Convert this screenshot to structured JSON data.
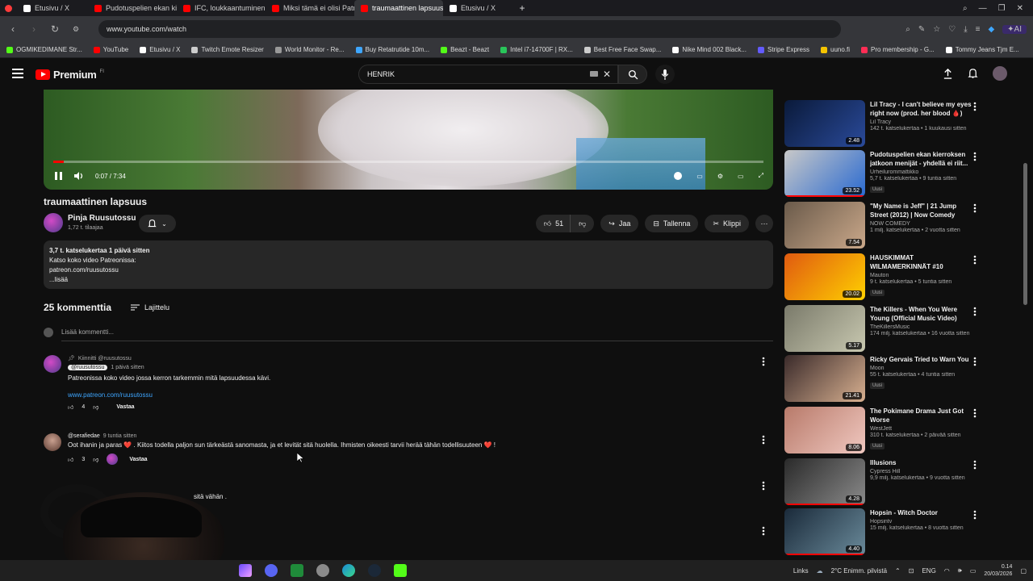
{
  "browser": {
    "tabs": [
      {
        "label": "Etusivu / X",
        "color": "#ffffff",
        "active": false
      },
      {
        "label": "Pudotuspelien ekan kierro",
        "color": "#ff0000",
        "active": false
      },
      {
        "label": "IFC, loukkaantuminen &",
        "color": "#ff0000",
        "active": false
      },
      {
        "label": "Miksi tämä ei olisi Patrik L",
        "color": "#ff0000",
        "active": false
      },
      {
        "label": "traumaattinen lapsuus",
        "color": "#ff0000",
        "active": true
      },
      {
        "label": "Etusivu / X",
        "color": "#ffffff",
        "active": false
      }
    ],
    "new_tab": "+",
    "url": "www.youtube.com/watch",
    "ai_label": "AI",
    "bookmarks": [
      {
        "label": "OGMIKEDIMANE Str...",
        "color": "#53fc18"
      },
      {
        "label": "YouTube",
        "color": "#ff0000"
      },
      {
        "label": "Etusivu / X",
        "color": "#ffffff"
      },
      {
        "label": "Twitch Emote Resizer",
        "color": "#cccccc"
      },
      {
        "label": "World Monitor - Re...",
        "color": "#999999"
      },
      {
        "label": "Buy Retatrutide 10m...",
        "color": "#3ea6ff"
      },
      {
        "label": "Beazt - Beazt",
        "color": "#53fc18"
      },
      {
        "label": "Intel i7-14700F | RX...",
        "color": "#29c55a"
      },
      {
        "label": "Best Free Face Swap...",
        "color": "#cccccc"
      },
      {
        "label": "Nike Mind 002 Black...",
        "color": "#ffffff"
      },
      {
        "label": "Stripe Express",
        "color": "#635bff"
      },
      {
        "label": "uuno.fi",
        "color": "#f5c400"
      },
      {
        "label": "Pro membership - G...",
        "color": "#ff2d55"
      },
      {
        "label": "Tommy Jeans Tjm E...",
        "color": "#ffffff"
      }
    ]
  },
  "yt": {
    "logo_text": "Premium",
    "logo_sup": "FI",
    "search_value": "HENRIK"
  },
  "player": {
    "time": "0:07 / 7:34",
    "progress": 0.015
  },
  "video": {
    "title": "traumaattinen lapsuus",
    "channel": "Pinja Ruusutossu",
    "subscribers": "1,72 t. tilaajaa",
    "likes": "51",
    "share": "Jaa",
    "save": "Tallenna",
    "clip": "Klippi"
  },
  "description": {
    "meta": "3,7 t. katselukertaa  1 päivä sitten",
    "lines": [
      "Katso koko video Patreonissa:",
      "patreon.com/ruusutossu"
    ],
    "more": "...lisää"
  },
  "comments": {
    "count": "25 kommenttia",
    "sort": "Lajittelu",
    "add_placeholder": "Lisää kommentti...",
    "items": [
      {
        "pinned": "Kiinnitti @ruusutossu",
        "handle": "@ruusutossu",
        "time": "1 päivä sitten",
        "text": "Patreonissa koko video jossa kerron tarkemmin mitä lapsuudessa kävi.",
        "link": "www.patreon.com/ruusutossu",
        "likes": "4",
        "reply": "Vastaa"
      },
      {
        "handle": "@serafiedae",
        "time": "9 tuntia sitten",
        "text": "Oot ihanin ja paras ❤️ . Kiitos todella paljon sun tärkeästä sanomasta, ja et levität sitä huolella. Ihmisten oikeesti  tarvii herää tähän todellisuuteen ❤️ !",
        "likes": "3",
        "reply": "Vastaa"
      },
      {
        "text": "sitä vähän ."
      }
    ]
  },
  "recommendations": [
    {
      "title": "Lil Tracy - I can't believe my eyes right now (prod. her blood 🩸)",
      "channel": "Lil Tracy",
      "meta": "142 t. katselukertaa • 1 kuukausi sitten",
      "duration": "2.48",
      "badge": "",
      "colors": [
        "#0a1a3a",
        "#2a4a9a"
      ],
      "watched": 0
    },
    {
      "title": "Pudotuspelien ekan kierroksen jatkoon menijät - yhdellä ei riit...",
      "channel": "Urheilurommattikko",
      "meta": "5,7 t. katselukertaa • 9 tuntia sitten",
      "duration": "23.52",
      "badge": "Uusi",
      "colors": [
        "#c8c8c8",
        "#2a6ad0"
      ],
      "watched": 1
    },
    {
      "title": "\"My Name is Jeff\" | 21 Jump Street (2012) | Now Comedy",
      "channel": "NOW COMEDY",
      "meta": "1 milj. katselukertaa • 2 vuotta sitten",
      "duration": "7.54",
      "badge": "",
      "colors": [
        "#6a5a4a",
        "#caa88a"
      ],
      "watched": 0
    },
    {
      "title": "HAUSKIMMAT WILMAMERKINNÄT #10",
      "channel": "Mauton",
      "meta": "9 t. katselukertaa • 5 tuntia sitten",
      "duration": "20.02",
      "badge": "Uusi",
      "colors": [
        "#e05a10",
        "#ffd000"
      ],
      "watched": 0
    },
    {
      "title": "The Killers - When You Were Young (Official Music Video)",
      "channel": "TheKillersMusic",
      "meta": "174 milj. katselukertaa • 16 vuotta sitten",
      "duration": "5.17",
      "badge": "",
      "colors": [
        "#7a7a6a",
        "#c8c8b0"
      ],
      "watched": 0
    },
    {
      "title": "Ricky Gervais Tried to Warn You",
      "channel": "Moon",
      "meta": "55 t. katselukertaa • 4 tuntia sitten",
      "duration": "21.41",
      "badge": "Uusi",
      "colors": [
        "#3a2a2a",
        "#d8b090"
      ],
      "watched": 0
    },
    {
      "title": "The Pokimane Drama Just Got Worse",
      "channel": "WestJett",
      "meta": "310 t. katselukertaa • 2 päivää sitten",
      "duration": "8.06",
      "badge": "Uusi",
      "colors": [
        "#b87a6a",
        "#f0c8c0"
      ],
      "watched": 0
    },
    {
      "title": "Illusions",
      "channel": "Cypress Hill",
      "meta": "9,9 milj. katselukertaa • 9 vuotta sitten",
      "duration": "4.28",
      "badge": "",
      "colors": [
        "#2a2a2a",
        "#8a8a8a"
      ],
      "watched": 1
    },
    {
      "title": "Hopsin - Witch Doctor",
      "channel": "Hopsintv",
      "meta": "15 milj. katselukertaa • 8 vuotta sitten",
      "duration": "4.40",
      "badge": "",
      "colors": [
        "#1a2a3a",
        "#6a8a9a"
      ],
      "watched": 1
    }
  ],
  "taskbar": {
    "links": "Links",
    "weather": "2°C  Enimm. pilvistä",
    "lang": "ENG",
    "time": "0.14",
    "date": "20/03/2026"
  }
}
